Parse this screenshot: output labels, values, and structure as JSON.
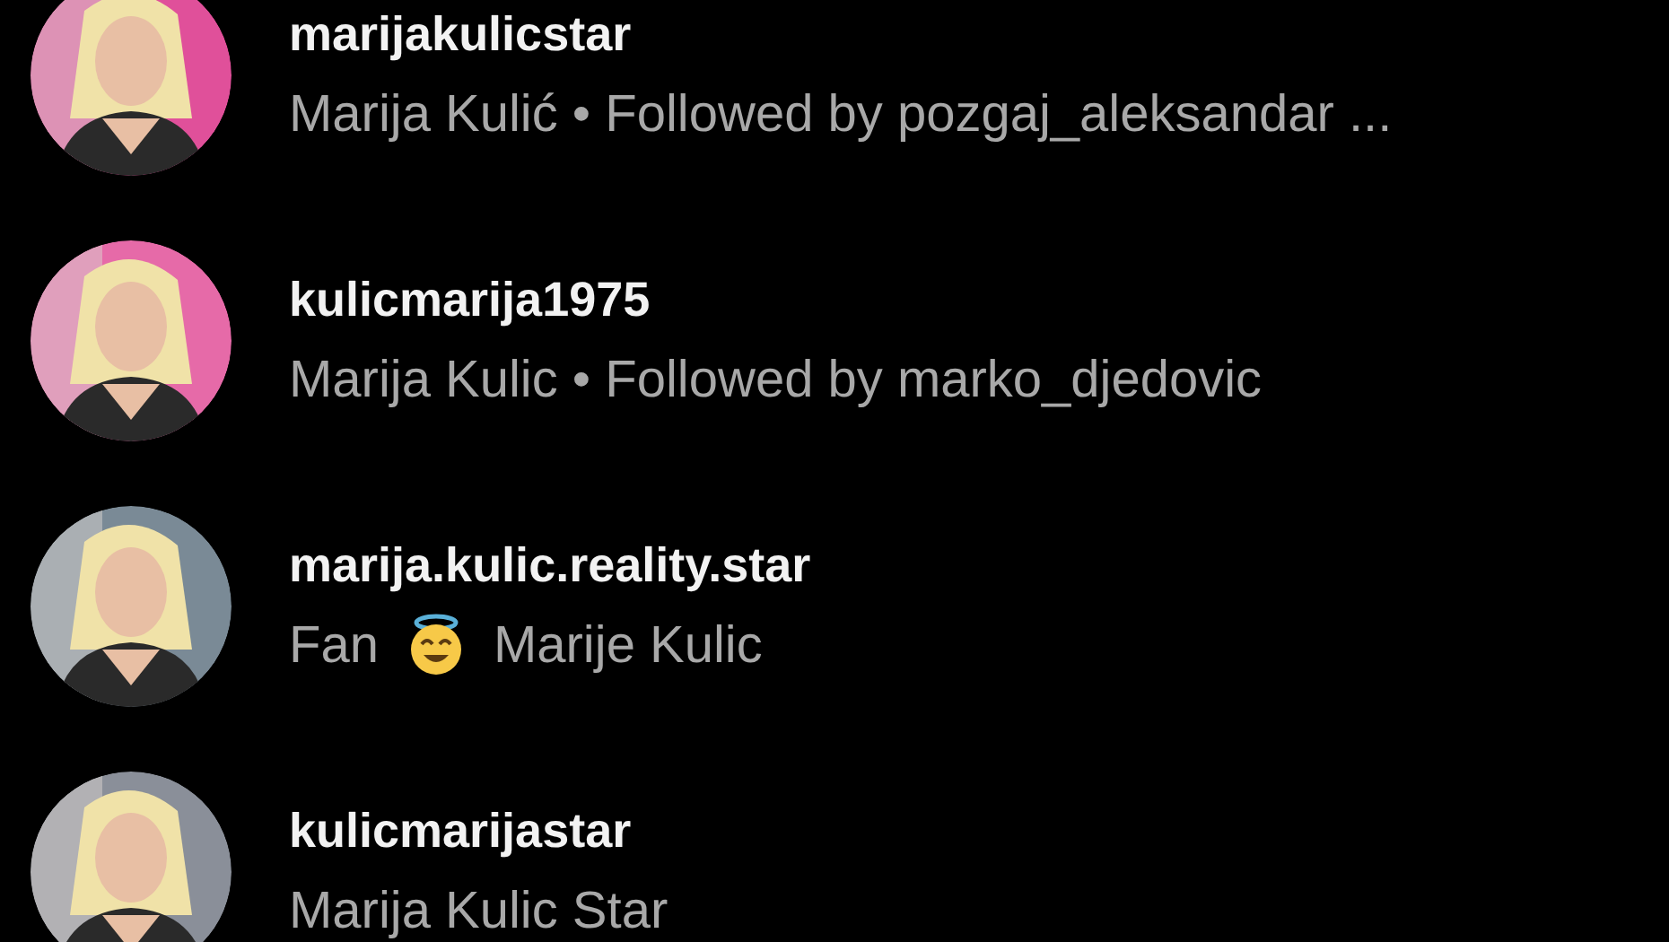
{
  "results": [
    {
      "username": "marijakulicstar",
      "subtitle": [
        {
          "kind": "text",
          "text": "Marija Kulić • Followed by pozgaj_aleksandar ..."
        }
      ],
      "avatar": {
        "kind": "picture",
        "color": "#e0509a"
      }
    },
    {
      "username": "kulicmarija1975",
      "subtitle": [
        {
          "kind": "text",
          "text": "Marija Kulic • Followed by marko_djedovic"
        }
      ],
      "avatar": {
        "kind": "picture",
        "color": "#e66aa8"
      }
    },
    {
      "username": "marija.kulic.reality.star",
      "subtitle": [
        {
          "kind": "text",
          "text": "Fan"
        },
        {
          "kind": "emoji"
        },
        {
          "kind": "text",
          "text": "Marije Kulic"
        }
      ],
      "avatar": {
        "kind": "picture",
        "color": "#7a8a96"
      }
    },
    {
      "username": "kulicmarijastar",
      "subtitle": [
        {
          "kind": "text",
          "text": "Marija Kulic Star"
        }
      ],
      "avatar": {
        "kind": "picture",
        "color": "#8a8f99"
      }
    }
  ]
}
